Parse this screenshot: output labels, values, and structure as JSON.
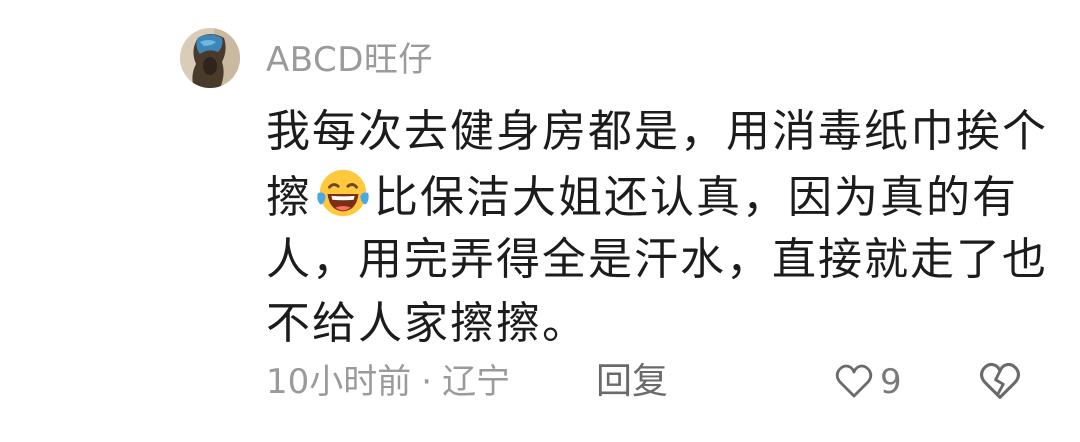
{
  "comment": {
    "author": "ABCD旺仔",
    "text_lines": [
      "我每次去健身房都是，用消毒纸巾挨个",
      "擦",
      "比保洁大姐还认真，因为真的有",
      "人，用完弄得全是汗水，直接就走了也",
      "不给人家擦擦。"
    ],
    "emoji": "laughing-with-tears-emoji",
    "time": "10小时前",
    "separator": "·",
    "location": "辽宁",
    "reply_label": "回复",
    "like_count": "9"
  },
  "colors": {
    "text": "#1c1c1c",
    "secondary": "#9a9a9a",
    "emoji_face": "#ffc83d",
    "emoji_tear": "#4aa8e8"
  }
}
